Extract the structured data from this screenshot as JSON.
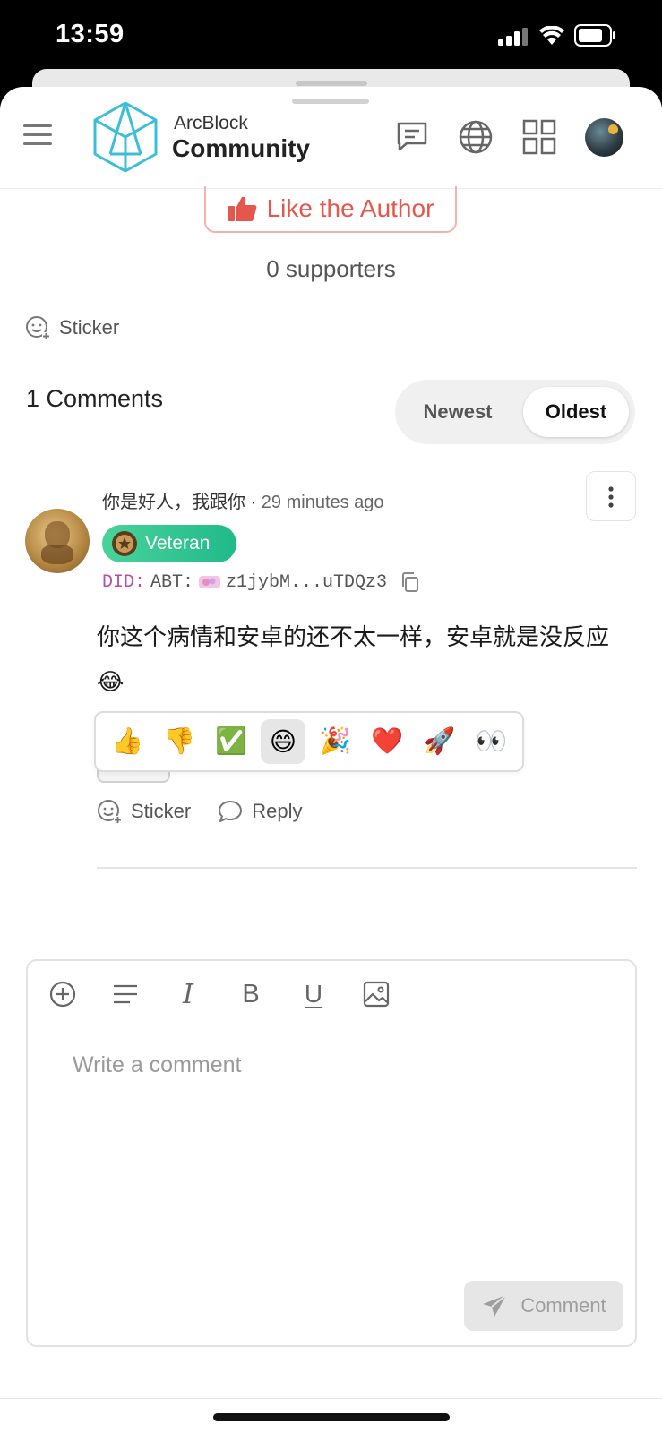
{
  "status_bar": {
    "time": "13:59"
  },
  "header": {
    "brand_top": "ArcBlock",
    "brand_bottom": "Community"
  },
  "post_footer": {
    "like_label": "Like the Author",
    "supporters": "0 supporters",
    "sticker_label": "Sticker"
  },
  "comments": {
    "title": "1 Comments",
    "sort_options": [
      "Newest",
      "Oldest"
    ],
    "selected_sort": "Oldest",
    "items": [
      {
        "author": "你是好人，我跟你",
        "separator": "·",
        "time_ago": "29 minutes ago",
        "badge": "Veteran",
        "did_prefix": "DID:",
        "did_chain": "ABT:",
        "did_value": "z1jybM...uTDQz3",
        "text": "你这个病情和安卓的还不太一样，安卓就是没反应😂",
        "reactions": [
          "👍",
          "👎",
          "✅",
          "😄",
          "🎉",
          "❤️",
          "🚀",
          "👀"
        ],
        "selected_reaction": "😄",
        "actions": {
          "sticker": "Sticker",
          "reply": "Reply"
        }
      }
    ]
  },
  "editor": {
    "toolbar": [
      "plus-circle-icon",
      "align-icon",
      "italic-icon",
      "bold-icon",
      "underline-icon",
      "image-icon"
    ],
    "bold_glyph": "B",
    "italic_glyph": "I",
    "underline_glyph": "U",
    "placeholder": "Write a comment",
    "submit_label": "Comment"
  },
  "colors": {
    "like_red": "#e5574c",
    "badge_green": "#21b98a",
    "did_purple": "#b84db0"
  }
}
